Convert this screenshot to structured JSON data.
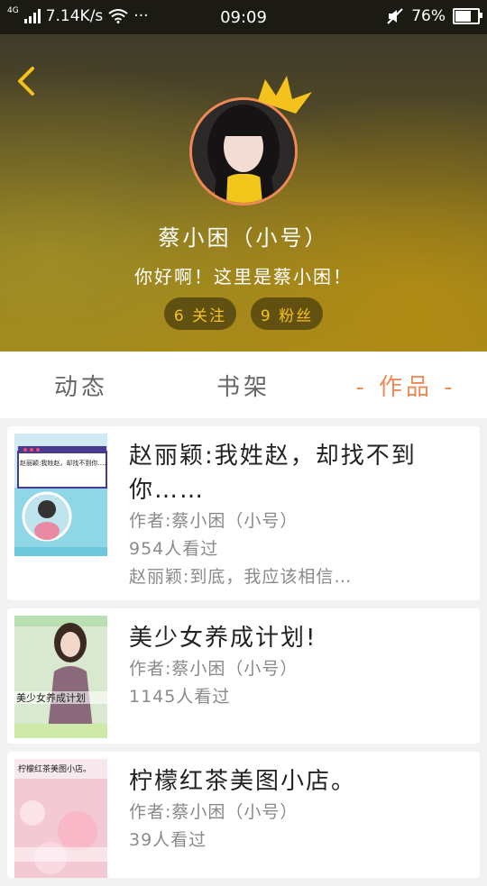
{
  "status_bar": {
    "network": "4G",
    "speed": "7.14K/s",
    "more": "···",
    "time": "09:09",
    "battery": "76%",
    "battery_level": 0.76
  },
  "profile": {
    "name": "蔡小困（小号）",
    "bio": "你好啊！这里是蔡小困！",
    "following_label": "6 关注",
    "followers_label": "9 粉丝"
  },
  "tabs": [
    {
      "label": "动态",
      "active": false
    },
    {
      "label": "书架",
      "active": false
    },
    {
      "label": "- 作品 -",
      "active": true
    }
  ],
  "works": [
    {
      "title": "赵丽颖:我姓赵，却找不到你……",
      "author": "作者:蔡小困（小号）",
      "views": "954人看过",
      "excerpt": "赵丽颖:到底，我应该相信…",
      "cover_text": "赵丽颖:我姓赵，却找不到你……"
    },
    {
      "title": "美少女养成计划!",
      "author": "作者:蔡小困（小号）",
      "views": "1145人看过",
      "excerpt": "",
      "cover_text": "美少女养成计划"
    },
    {
      "title": "柠檬红茶美图小店。",
      "author": "作者:蔡小困（小号）",
      "views": "39人看过",
      "excerpt": "",
      "cover_text": "柠檬红茶美图小店。"
    }
  ],
  "colors": {
    "accent": "#f08a55",
    "pill_text": "#f5c11c"
  }
}
